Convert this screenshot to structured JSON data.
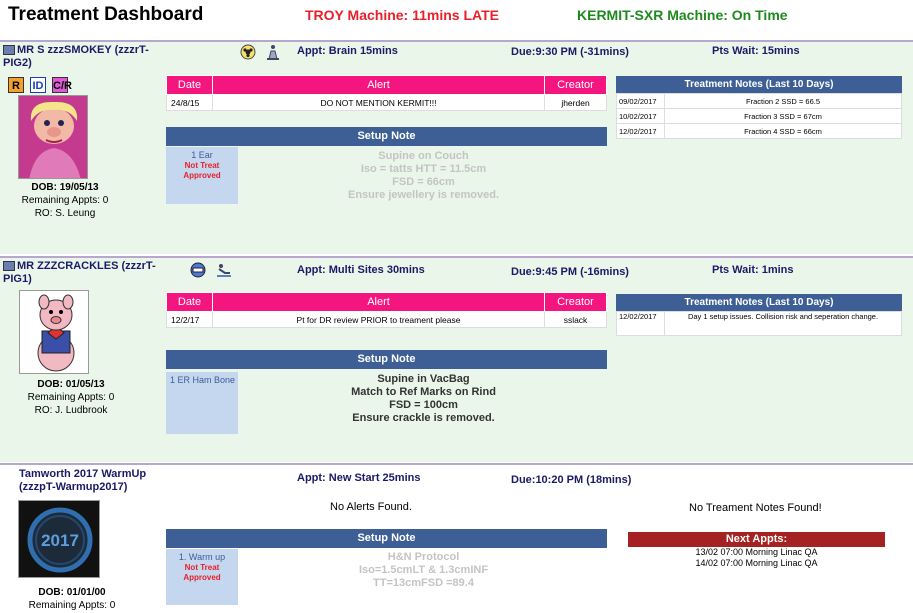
{
  "header": {
    "title": "Treatment Dashboard",
    "troy_status": "TROY Machine: 11mins LATE",
    "kermit_status": "KERMIT-SXR Machine: On Time",
    "colors": {
      "late": "#e8202a",
      "ontime": "#1e8a1e",
      "pink": "#f5157e",
      "blue": "#3d5f95",
      "maroon": "#a52222"
    }
  },
  "patients": [
    {
      "name": "MR S zzzSMOKEY (zzzrT-PIG2)",
      "badges": [
        "R",
        "ID",
        "C/R"
      ],
      "icons": [
        "biohazard-icon",
        "patient-position-icon"
      ],
      "photo": "miss-piggy-photo",
      "dob": "DOB: 19/05/13",
      "remaining": "Remaining Appts: 0",
      "ro": "RO: S. Leung",
      "appt": "Appt: Brain 15mins",
      "due": "Due:9:30 PM (-31mins)",
      "wait": "Pts Wait: 15mins",
      "alert_headers": [
        "Date",
        "Alert",
        "Creator"
      ],
      "alerts": [
        {
          "date": "24/8/15",
          "alert": "DO NOT MENTION KERMIT!!!",
          "creator": "jherden"
        }
      ],
      "notes_title": "Treatment Notes (Last 10 Days)",
      "notes": [
        {
          "date": "09/02/2017",
          "text": "Fraction 2 SSD = 66.5"
        },
        {
          "date": "10/02/2017",
          "text": "Fraction 3 SSD = 67cm"
        },
        {
          "date": "12/02/2017",
          "text": "Fraction 4 SSD = 66cm"
        }
      ],
      "setup_title": "Setup Note",
      "fraction": "1 Ear",
      "fraction_status": "Not Treat Approved",
      "setup_lines": [
        "Supine on Couch",
        "Iso = tatts HTT = 11.5cm",
        "FSD = 66cm",
        "Ensure jewellery is removed."
      ]
    },
    {
      "name": "MR ZZZCRACKLES (zzzrT-PIG1)",
      "icons": [
        "face-icon",
        "patient-position-icon"
      ],
      "photo": "porky-pig-photo",
      "dob": "DOB: 01/05/13",
      "remaining": "Remaining Appts: 0",
      "ro": "RO: J. Ludbrook",
      "appt": "Appt: Multi Sites 30mins",
      "due": "Due:9:45 PM (-16mins)",
      "wait": "Pts Wait: 1mins",
      "alert_headers": [
        "Date",
        "Alert",
        "Creator"
      ],
      "alerts": [
        {
          "date": "12/2/17",
          "alert": "Pt for DR review PRIOR to treament please",
          "creator": "sslack"
        }
      ],
      "notes_title": "Treatment Notes (Last 10 Days)",
      "notes": [
        {
          "date": "12/02/2017",
          "text": "Day 1 setup issues. Collision risk and seperation change."
        }
      ],
      "setup_title": "Setup Note",
      "fraction": "1 ER Ham Bone",
      "setup_lines": [
        "Supine in VacBag",
        "Match to Ref Marks on Rind",
        "FSD = 100cm",
        "Ensure crackle is removed."
      ]
    },
    {
      "name": "Tamworth 2017 WarmUp (zzzpT-Warmup2017)",
      "photo": "warmup-2017-logo",
      "logo_text": "2017",
      "dob": "DOB: 01/01/00",
      "remaining": "Remaining Appts: 0",
      "appt": "Appt: New Start 25mins",
      "due": "Due:10:20 PM (18mins)",
      "no_alerts": "No Alerts Found.",
      "no_notes": "No Treament Notes Found!",
      "setup_title": "Setup Note",
      "fraction": "1. Warm up",
      "fraction_status": "Not Treat Approved",
      "setup_lines": [
        "H&N Protocol",
        "Iso=1.5cmLT & 1.3cmINF",
        "TT=13cmFSD =89.4"
      ],
      "next_title": "Next Appts:",
      "next_appts": [
        "13/02 07:00 Morning Linac QA",
        "14/02 07:00 Morning Linac QA"
      ]
    }
  ]
}
